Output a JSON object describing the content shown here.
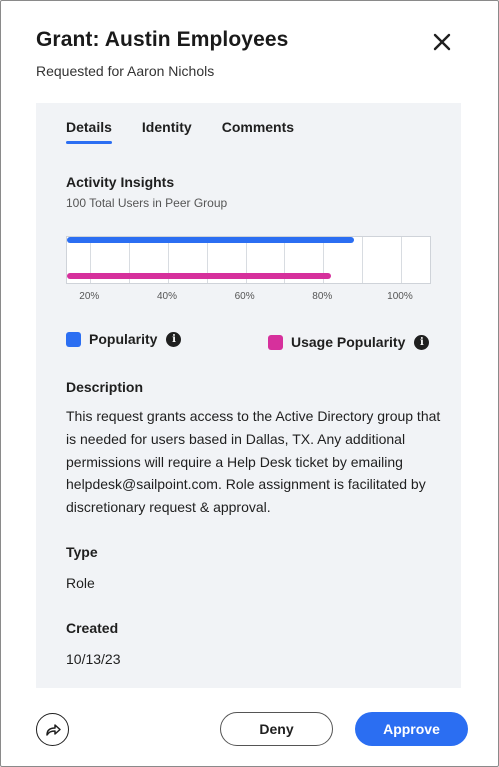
{
  "header": {
    "title": "Grant: Austin Employees",
    "subtitle": "Requested for Aaron Nichols",
    "close_icon": "close-icon"
  },
  "tabs": [
    {
      "label": "Details",
      "active": true
    },
    {
      "label": "Identity",
      "active": false
    },
    {
      "label": "Comments",
      "active": false
    }
  ],
  "insights": {
    "title": "Activity Insights",
    "subtitle": "100 Total Users in Peer Group"
  },
  "chart_data": {
    "type": "bar",
    "orientation": "horizontal",
    "series": [
      {
        "name": "Popularity",
        "value": 88,
        "color": "#2b6ef2"
      },
      {
        "name": "Usage Popularity",
        "value": 82,
        "color": "#d6309c"
      }
    ],
    "xlim": [
      14,
      108
    ],
    "ticks": [
      "20%",
      "40%",
      "60%",
      "80%",
      "100%"
    ],
    "tick_values": [
      20,
      40,
      60,
      80,
      100
    ],
    "grid": true,
    "legend_position": "bottom"
  },
  "legend": {
    "popularity_label": "Popularity",
    "usage_label": "Usage Popularity",
    "info_glyph": "i"
  },
  "description": {
    "label": "Description",
    "text": "This request grants access to the Active Directory group that is needed for users based in Dallas, TX. Any additional permissions will require a Help Desk ticket by emailing helpdesk@sailpoint.com. Role assignment is facilitated by discretionary request & approval."
  },
  "type": {
    "label": "Type",
    "value": "Role"
  },
  "created": {
    "label": "Created",
    "value": "10/13/23"
  },
  "footer": {
    "share_icon": "share-icon",
    "deny_label": "Deny",
    "approve_label": "Approve"
  },
  "colors": {
    "accent": "#2b6ef2",
    "magenta": "#d6309c",
    "panel_bg": "#f1f3f6"
  }
}
